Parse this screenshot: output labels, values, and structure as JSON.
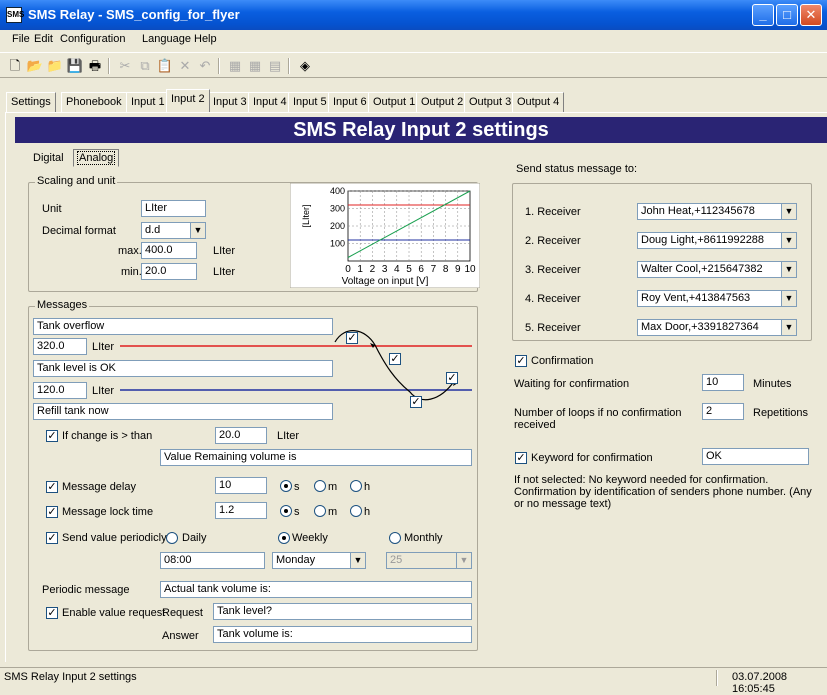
{
  "window": {
    "title": "SMS Relay - SMS_config_for_flyer",
    "app_icon": "SMS"
  },
  "menu": [
    "File",
    "Edit",
    "Configuration",
    "Language",
    "Help"
  ],
  "tabs": [
    "Settings",
    "Phonebook",
    "Input 1",
    "Input 2",
    "Input 3",
    "Input 4",
    "Input 5",
    "Input 6",
    "Output 1",
    "Output 2",
    "Output 3",
    "Output 4"
  ],
  "active_tab": "Input 2",
  "banner": "SMS Relay Input 2 settings",
  "subtabs": {
    "digital": "Digital",
    "analog": "Analog"
  },
  "scaling": {
    "title": "Scaling and unit",
    "unit_label": "Unit",
    "unit_value": "LIter",
    "decimal_label": "Decimal format",
    "decimal_value": "d.d",
    "max_label": "max.",
    "max_value": "400.0",
    "max_unit": "LIter",
    "min_label": "min.",
    "min_value": "20.0",
    "min_unit": "LIter"
  },
  "chart_data": {
    "type": "line",
    "x": [
      0,
      10
    ],
    "values": [
      20,
      400
    ],
    "xlim": [
      0,
      10
    ],
    "ylim": [
      0,
      400
    ],
    "xticks": [
      "0",
      "1",
      "2",
      "3",
      "4",
      "5",
      "6",
      "7",
      "8",
      "9",
      "10"
    ],
    "yticks": [
      "400",
      "300",
      "200",
      "100"
    ],
    "xlabel": "Voltage on input [V]",
    "ylabel": "[LIter]",
    "thresholds": [
      320,
      120
    ],
    "threshold_colors": [
      "#e02020",
      "#2030a0"
    ],
    "line_color": "#1aa050",
    "grid": true
  },
  "messages": {
    "title": "Messages",
    "overflow_text": "Tank overflow",
    "upper_value": "320.0",
    "upper_unit": "LIter",
    "ok_text": "Tank level is OK",
    "lower_value": "120.0",
    "lower_unit": "LIter",
    "refill_text": "Refill tank now",
    "change_label": "If change is > than",
    "change_value": "20.0",
    "change_unit": "LIter",
    "change_message": "Value Remaining volume is",
    "delay_label": "Message delay",
    "delay_value": "10",
    "locktime_label": "Message lock time",
    "locktime_value": "1.2",
    "unit_s": "s",
    "unit_m": "m",
    "unit_h": "h",
    "periodic_label": "Send value periodicly",
    "daily": "Daily",
    "weekly": "Weekly",
    "monthly": "Monthly",
    "time_value": "08:00",
    "weekday_value": "Monday",
    "monthday_value": "25",
    "periodic_msg_label": "Periodic message",
    "periodic_msg_value": "Actual tank volume is:",
    "enable_request_label": "Enable value request",
    "request_label": "Request",
    "request_value": "Tank level?",
    "answer_label": "Answer",
    "answer_value": "Tank volume is:"
  },
  "receivers": {
    "title": "Send status message to:",
    "list": [
      {
        "label": "1. Receiver",
        "value": "John Heat,+112345678"
      },
      {
        "label": "2. Receiver",
        "value": "Doug Light,+8611992288"
      },
      {
        "label": "3. Receiver",
        "value": "Walter Cool,+215647382"
      },
      {
        "label": "4. Receiver",
        "value": "Roy Vent,+413847563"
      },
      {
        "label": "5. Receiver",
        "value": "Max Door,+3391827364"
      }
    ]
  },
  "confirmation": {
    "label": "Confirmation",
    "waiting_label": "Waiting for confirmation",
    "waiting_value": "10",
    "waiting_unit": "Minutes",
    "loops_label": "Number of loops if no confirmation received",
    "loops_value": "2",
    "loops_unit": "Repetitions",
    "keyword_label": "Keyword for confirmation",
    "keyword_value": "OK",
    "note": "If not selected: No keyword needed for confirmation.  Confirmation by identification of senders phone number. (Any or no message text)"
  },
  "status": {
    "text": "SMS Relay Input 2 settings",
    "datetime": "03.07.2008 16:05:45"
  }
}
